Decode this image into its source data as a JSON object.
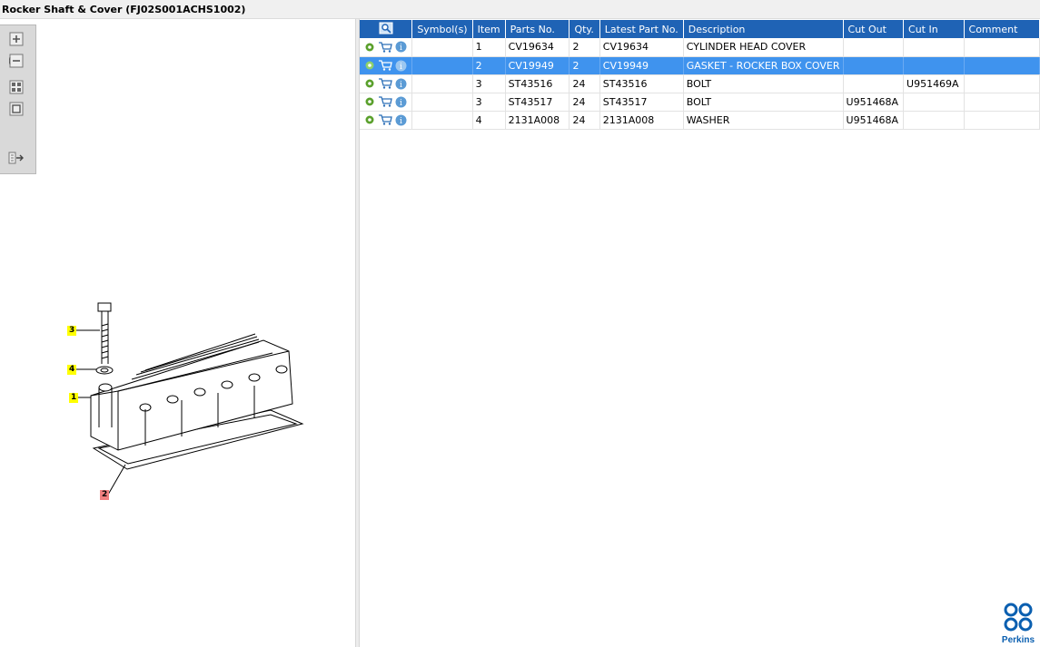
{
  "window": {
    "title": "Rocker Shaft & Cover (FJ02S001ACHS1002)"
  },
  "toolbar": {
    "icons": [
      "zoom-in-icon",
      "zoom-out-icon",
      "fit-icon",
      "actual-size-icon",
      "export-icon"
    ]
  },
  "diagram": {
    "callouts": [
      {
        "label": "3",
        "color": "#ffff00"
      },
      {
        "label": "4",
        "color": "#ffff00"
      },
      {
        "label": "1",
        "color": "#ffff00"
      },
      {
        "label": "2",
        "color": "#f08080"
      }
    ]
  },
  "table": {
    "columns": [
      "",
      "Symbol(s)",
      "Item",
      "Parts No.",
      "Qty.",
      "Latest Part No.",
      "Description",
      "Cut Out",
      "Cut In",
      "Comment"
    ],
    "rows": [
      {
        "symbols": "",
        "item": "1",
        "part_no": "CV19634",
        "qty": "2",
        "latest_part_no": "CV19634",
        "description": "CYLINDER HEAD COVER",
        "cut_out": "",
        "cut_in": "",
        "comment": "",
        "selected": false
      },
      {
        "symbols": "",
        "item": "2",
        "part_no": "CV19949",
        "qty": "2",
        "latest_part_no": "CV19949",
        "description": "GASKET - ROCKER BOX COVER",
        "cut_out": "",
        "cut_in": "",
        "comment": "",
        "selected": true
      },
      {
        "symbols": "",
        "item": "3",
        "part_no": "ST43516",
        "qty": "24",
        "latest_part_no": "ST43516",
        "description": "BOLT",
        "cut_out": "",
        "cut_in": "U951469A",
        "comment": "",
        "selected": false
      },
      {
        "symbols": "",
        "item": "3",
        "part_no": "ST43517",
        "qty": "24",
        "latest_part_no": "ST43517",
        "description": "BOLT",
        "cut_out": "U951468A",
        "cut_in": "",
        "comment": "",
        "selected": false
      },
      {
        "symbols": "",
        "item": "4",
        "part_no": "2131A008",
        "qty": "24",
        "latest_part_no": "2131A008",
        "description": "WASHER",
        "cut_out": "U951468A",
        "cut_in": "",
        "comment": "",
        "selected": false
      }
    ]
  },
  "brand": {
    "name": "Perkins",
    "color": "#0a5fb0"
  },
  "colors": {
    "header": "#1f63b5",
    "selected_row": "#3f93ee"
  }
}
